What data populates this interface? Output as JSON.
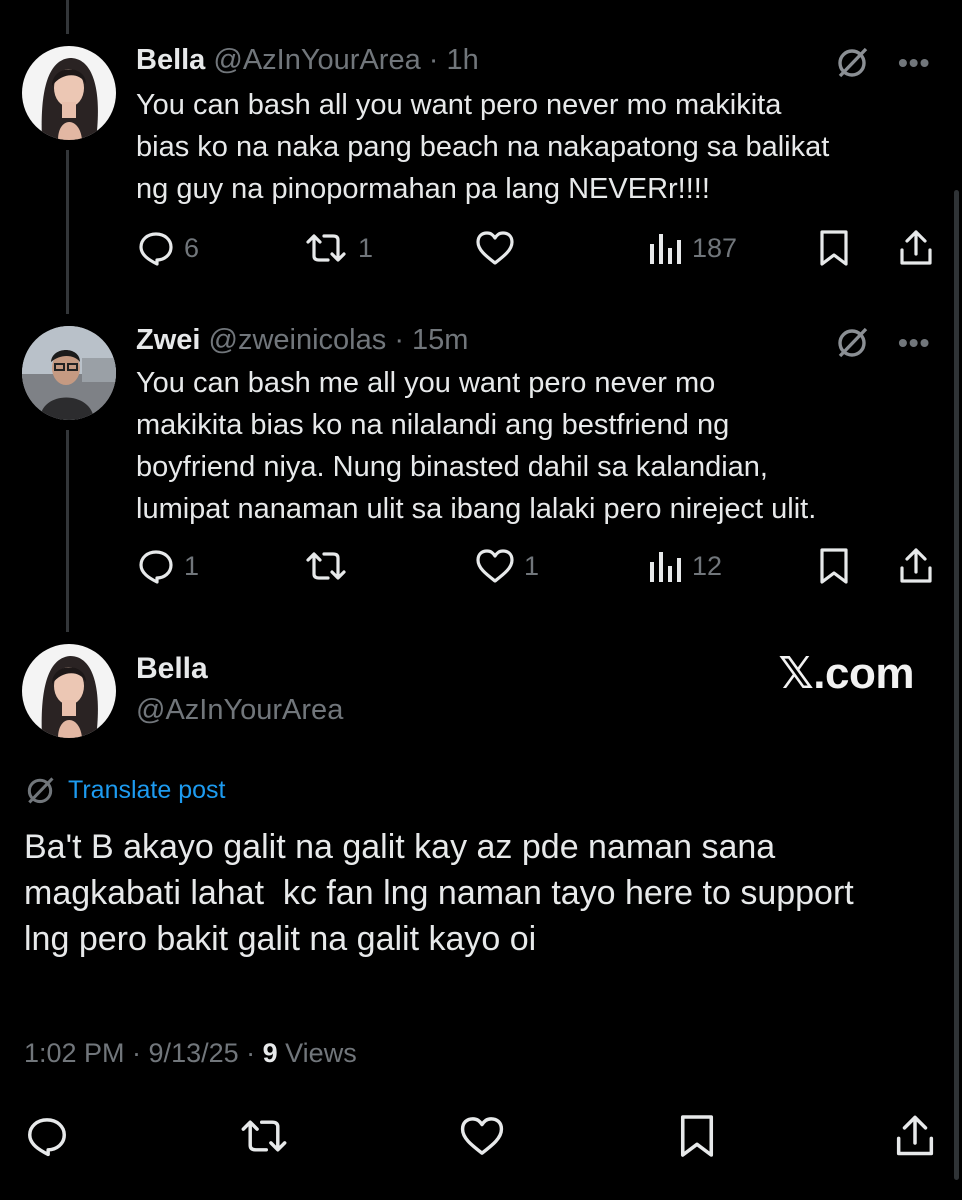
{
  "replies": [
    {
      "name": "Bella",
      "handle": "@AzInYourArea",
      "time": "· 1h",
      "lines": [
        "You can bash all you want pero never mo makikita",
        "bias ko na naka pang beach na nakapatong sa balikat",
        "ng guy na pinopormahan pa lang NEVERr!!!!"
      ],
      "more": "•••",
      "stats": {
        "replies": "6",
        "reposts": "1",
        "likes": "",
        "views": "187"
      }
    },
    {
      "name": "Zwei",
      "handle": "@zweinicolas",
      "time": "· 15m",
      "lines": [
        "You can bash me all you want pero never mo",
        "makikita bias ko na nilalandi ang bestfriend ng",
        "boyfriend niya. Nung binasted dahil sa kalandian,",
        "lumipat nanaman ulit sa ibang lalaki pero nireject ulit."
      ],
      "more": "•••",
      "stats": {
        "replies": "1",
        "reposts": "",
        "likes": "1",
        "views": "12"
      }
    }
  ],
  "main_post": {
    "name": "Bella",
    "handle": "@AzInYourArea",
    "translate_label": "Translate post",
    "lines": [
      "Ba't B akayo galit na galit kay az pde naman sana",
      "magkabati lahat  kc fan lng naman tayo here to support",
      "lng pero bakit galit na galit kayo oi"
    ],
    "timestamp": "1:02 PM · 9/13/25 · ",
    "views_count": "9",
    "views_label": " Views"
  },
  "watermark": "𝕏.com",
  "icons": [
    "grok-icon",
    "more-icon",
    "reply-icon",
    "repost-icon",
    "like-icon",
    "views-icon",
    "bookmark-icon",
    "share-icon",
    "translate-icon"
  ],
  "colors": {
    "background": "#000000",
    "text": "#e7e9ea",
    "muted": "#71767b",
    "link": "#1d9bf0",
    "thread_line": "#333639"
  }
}
